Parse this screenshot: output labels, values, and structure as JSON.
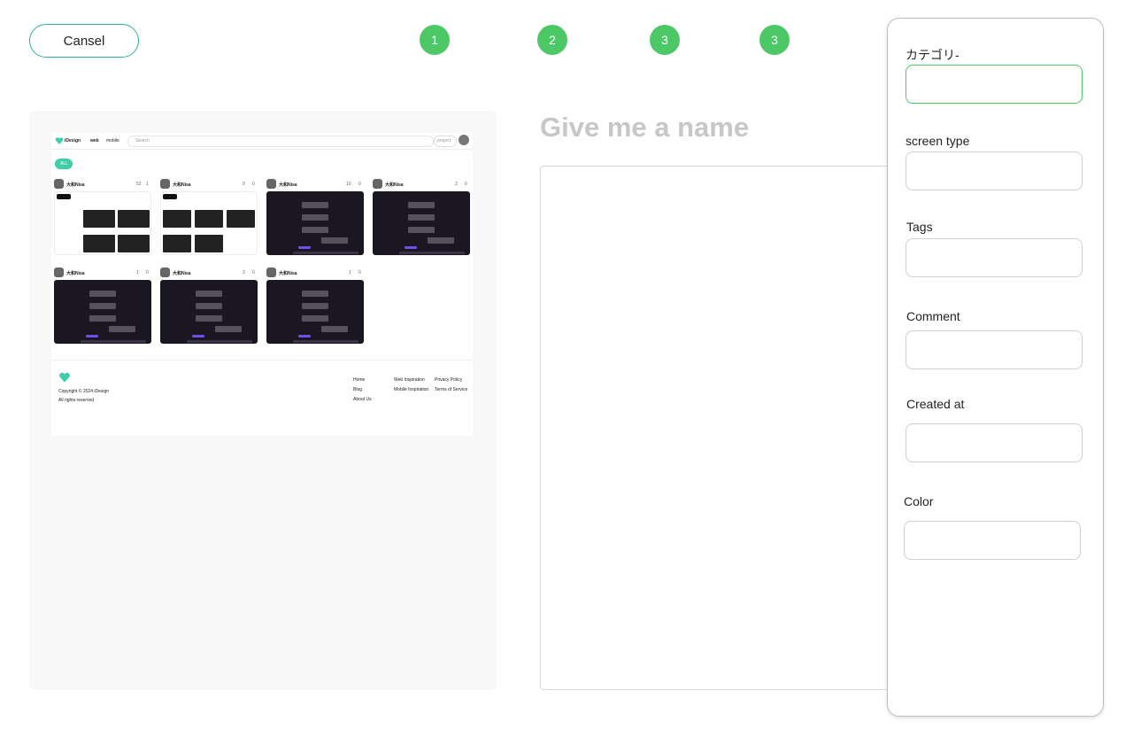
{
  "header": {
    "cancel_label": "Cansel",
    "steps": [
      "1",
      "2",
      "3",
      "3"
    ]
  },
  "colors": {
    "accent": "#4cc866",
    "cancel_border": "#2bb39a",
    "title_placeholder": "#c7c7c7"
  },
  "preview": {
    "nav": {
      "brand": "iDesign",
      "tab_web": "web",
      "tab_mobile": "mobile",
      "search_placeholder": "Search",
      "project_label": "project"
    },
    "filter_chip": "ALL",
    "cards": [
      {
        "author": "大和Nisa",
        "views": "52",
        "likes": "1"
      },
      {
        "author": "大和Nisa",
        "views": "9",
        "likes": "0"
      },
      {
        "author": "大和Nisa",
        "views": "10",
        "likes": "0"
      },
      {
        "author": "大和Nisa",
        "views": "3",
        "likes": "0"
      },
      {
        "author": "大和Nisa",
        "views": "1",
        "likes": "0"
      },
      {
        "author": "大和Nisa",
        "views": "3",
        "likes": "0"
      },
      {
        "author": "大和Nisa",
        "views": "1",
        "likes": "0"
      }
    ],
    "footer": {
      "copyright": "Copyright © 2024 iDesign",
      "rights": "All rights reserved",
      "links_col1": [
        "Home",
        "Blog",
        "About Us"
      ],
      "links_col2": [
        "Web Inspiration",
        "Mobile Inspiration"
      ],
      "links_col3": [
        "Privacy Policy",
        "Terms of Service"
      ]
    }
  },
  "main": {
    "title_placeholder": "Give me a name"
  },
  "side_panel": {
    "fields": [
      {
        "label": "カテゴリ-",
        "value": ""
      },
      {
        "label": "screen  type",
        "value": ""
      },
      {
        "label": "Tags",
        "value": ""
      },
      {
        "label": "Comment",
        "value": ""
      },
      {
        "label": "Created at",
        "value": ""
      },
      {
        "label": "Color",
        "value": ""
      }
    ]
  }
}
